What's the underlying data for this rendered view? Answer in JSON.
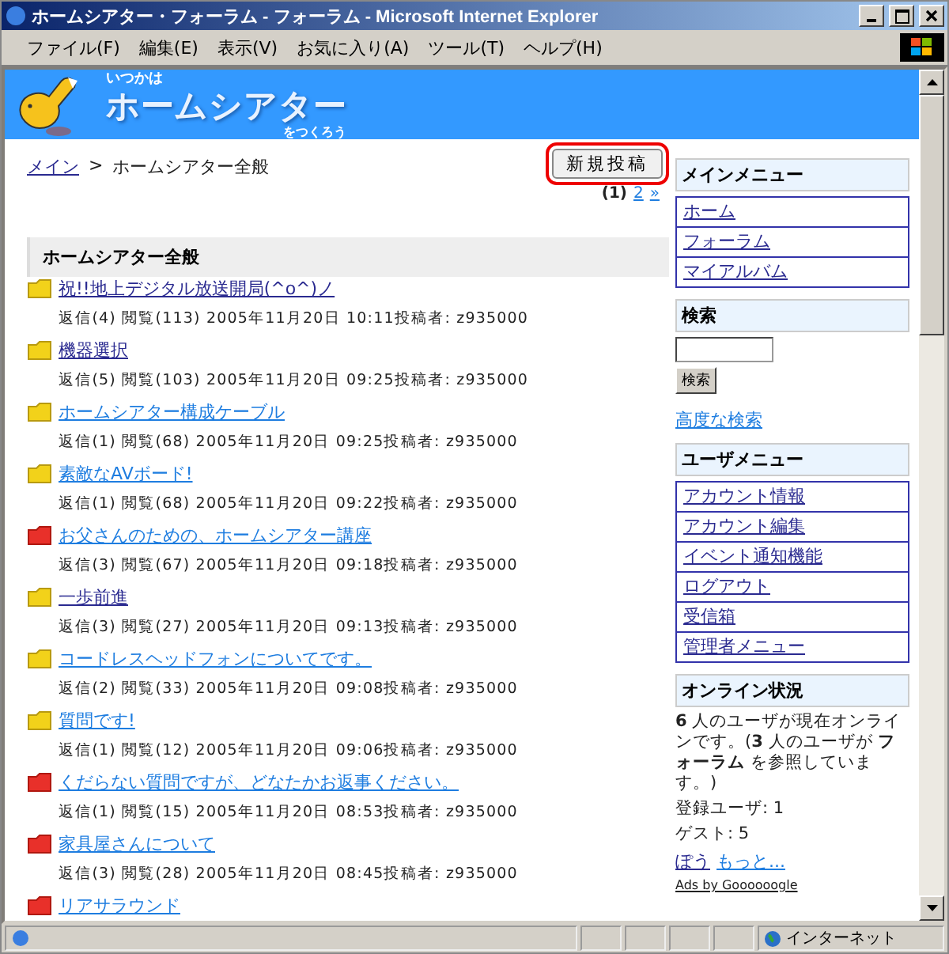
{
  "window": {
    "title": "ホームシアター・フォーラム - フォーラム - Microsoft Internet Explorer"
  },
  "menu": [
    "ファイル(F)",
    "編集(E)",
    "表示(V)",
    "お気に入り(A)",
    "ツール(T)",
    "ヘルプ(H)"
  ],
  "banner": {
    "tagline": "いつかは",
    "title": "ホームシアター",
    "subtitle": "をつくろう"
  },
  "breadcrumb": {
    "link": "メイン",
    "separator": ">",
    "current": "ホームシアター全般"
  },
  "new_post_button": "新規投稿",
  "pager": {
    "current": "(1)",
    "pages": [
      "2",
      "»"
    ]
  },
  "forum": {
    "heading": "ホームシアター全般",
    "topics": [
      {
        "title": "祝!!地上デジタル放送開局(^o^)ノ",
        "meta": "返信(4) 閲覧(113) 2005年11月20日 10:11投稿者: z935000",
        "hot": false,
        "visited": true
      },
      {
        "title": "機器選択",
        "meta": "返信(5) 閲覧(103) 2005年11月20日 09:25投稿者: z935000",
        "hot": false,
        "visited": true
      },
      {
        "title": "ホームシアター構成ケーブル",
        "meta": "返信(1) 閲覧(68) 2005年11月20日 09:25投稿者: z935000",
        "hot": false,
        "visited": false
      },
      {
        "title": "素敵なAVボード!",
        "meta": "返信(1) 閲覧(68) 2005年11月20日 09:22投稿者: z935000",
        "hot": false,
        "visited": false
      },
      {
        "title": "お父さんのための、ホームシアター講座",
        "meta": "返信(3) 閲覧(67) 2005年11月20日 09:18投稿者: z935000",
        "hot": true,
        "visited": false
      },
      {
        "title": "一歩前進",
        "meta": "返信(3) 閲覧(27) 2005年11月20日 09:13投稿者: z935000",
        "hot": false,
        "visited": true
      },
      {
        "title": "コードレスヘッドフォンについてです。",
        "meta": "返信(2) 閲覧(33) 2005年11月20日 09:08投稿者: z935000",
        "hot": false,
        "visited": false
      },
      {
        "title": "質問です!",
        "meta": "返信(1) 閲覧(12) 2005年11月20日 09:06投稿者: z935000",
        "hot": false,
        "visited": false
      },
      {
        "title": "くだらない質問ですが、どなたかお返事ください。",
        "meta": "返信(1) 閲覧(15) 2005年11月20日 08:53投稿者: z935000",
        "hot": true,
        "visited": false
      },
      {
        "title": "家具屋さんについて",
        "meta": "返信(3) 閲覧(28) 2005年11月20日 08:45投稿者: z935000",
        "hot": true,
        "visited": false
      },
      {
        "title": "リアサラウンド",
        "hot": true,
        "visited": false
      }
    ]
  },
  "sidebar": {
    "main_menu": {
      "heading": "メインメニュー",
      "items": [
        {
          "label": "ホーム",
          "visited": true
        },
        {
          "label": "フォーラム",
          "visited": true
        },
        {
          "label": "マイアルバム",
          "visited": true
        }
      ]
    },
    "search": {
      "heading": "検索",
      "button": "検索",
      "advanced": "高度な検索"
    },
    "user_menu": {
      "heading": "ユーザメニュー",
      "items": [
        {
          "label": "アカウント情報",
          "visited": true
        },
        {
          "label": "アカウント編集",
          "visited": true
        },
        {
          "label": "イベント通知機能",
          "visited": true
        },
        {
          "label": "ログアウト",
          "visited": true
        },
        {
          "label": "受信箱",
          "visited": true
        },
        {
          "label": "管理者メニュー",
          "visited": true
        }
      ]
    },
    "online": {
      "heading": "オンライン状況",
      "summary": "**6** 人のユーザが現在オンラインです。(**3** 人のユーザが **フォーラム** を参照しています。)",
      "registered": "登録ユーザ: 1",
      "guests": "ゲスト: 5",
      "links": [
        "ぽう",
        "もっと..."
      ],
      "ads": "Ads by Goooooogle"
    }
  },
  "status_bar": {
    "zone": "インターネット"
  }
}
